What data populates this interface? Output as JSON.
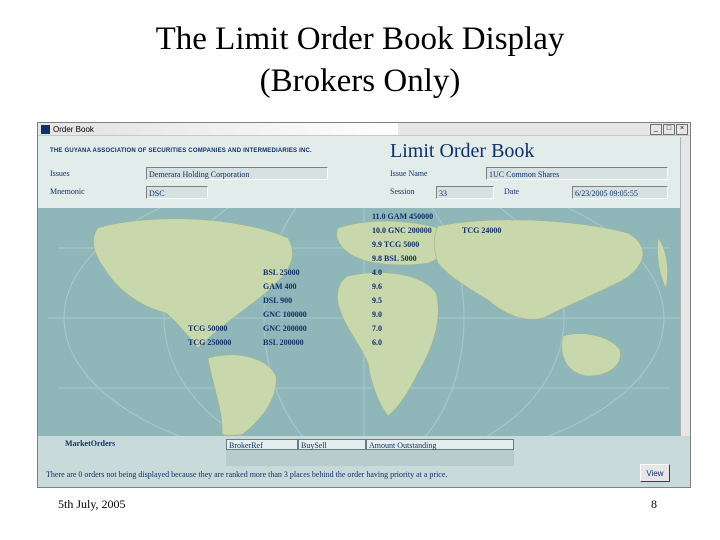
{
  "slide": {
    "title_line1": "The Limit Order Book Display",
    "title_line2": "(Brokers Only)",
    "footer_date": "5th July, 2005",
    "page_number": "8"
  },
  "window": {
    "title": "Order Book",
    "minimize": "_",
    "maximize": "□",
    "close": "×",
    "association": "THE GUYANA ASSOCIATION OF SECURITIES COMPANIES AND INTERMEDIARIES INC.",
    "heading": "Limit Order Book",
    "labels": {
      "issues": "Issues",
      "mnemonic": "Mnemonic",
      "issue_name": "Issue Name",
      "session": "Session",
      "date": "Date"
    },
    "fields": {
      "issues": "Demerara Holding Corporation",
      "mnemonic": "DSC",
      "issue_name": "1UC Common Shares",
      "session": "33",
      "date": "6/23/2005 09:05:55"
    }
  },
  "order_book": {
    "ask_rows": [
      {
        "text": "11.0 GAM  450000"
      },
      {
        "text": "10.0 GNC  200000"
      },
      {
        "text": "9.9 TCG  5000"
      },
      {
        "text": "9.8 BSL  5000"
      }
    ],
    "ask_extra": "TCG  24000",
    "price_rows": [
      "4.0",
      "9.6",
      "9.5",
      "9.0",
      "7.0",
      "6.0"
    ],
    "bid_rows": [
      {
        "text": "BSL  25000"
      },
      {
        "text": "GAM  400"
      },
      {
        "text": "DSL  900"
      },
      {
        "text": "GNC  100000"
      },
      {
        "text": "GNC  200000"
      },
      {
        "text": "BSL  200000"
      }
    ],
    "bid_left_rows": [
      {
        "text": "TCG  50000"
      },
      {
        "text": "TCG  250000"
      }
    ]
  },
  "market_orders": {
    "label": "MarketOrders",
    "columns": [
      "BrokerRef",
      "BuySell",
      "Amount Outstanding"
    ],
    "note": "There are 0        orders not being displayed because they are ranked more than 3 places behind the order having priority at a price.",
    "view_button": "View"
  },
  "colors": {
    "map_background": "#8fb7ba",
    "land": "#c9d8ac",
    "text_blue": "#10306a"
  }
}
